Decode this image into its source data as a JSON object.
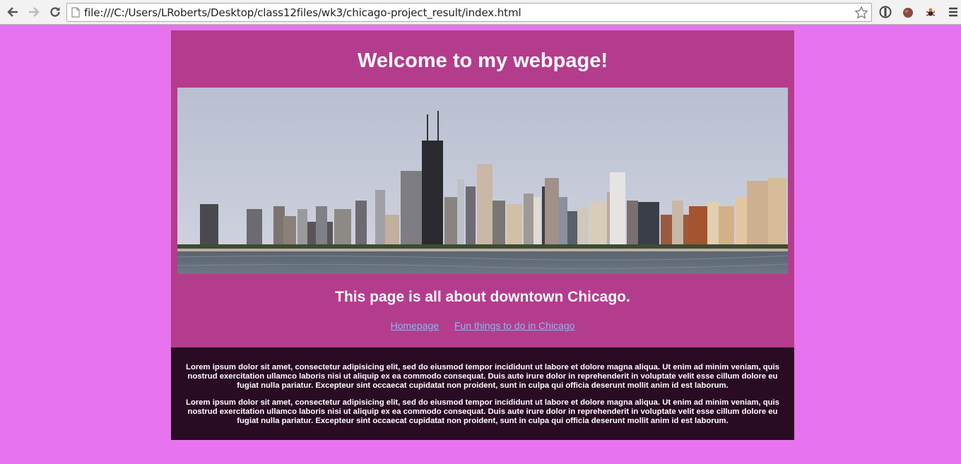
{
  "browser": {
    "url": "file:///C:/Users/LRoberts/Desktop/class12files/wk3/chicago-project_result/index.html"
  },
  "page": {
    "title": "Welcome to my webpage!",
    "subtitle": "This page is all about downtown Chicago.",
    "nav": [
      {
        "label": "Homepage"
      },
      {
        "label": "Fun things to do in Chicago"
      }
    ],
    "paragraphs": [
      "Lorem ipsum dolor sit amet, consectetur adipisicing elit, sed do eiusmod tempor incididunt ut labore et dolore magna aliqua. Ut enim ad minim veniam, quis nostrud exercitation ullamco laboris nisi ut aliquip ex ea commodo consequat. Duis aute irure dolor in reprehenderit in voluptate velit esse cillum dolore eu fugiat nulla pariatur. Excepteur sint occaecat cupidatat non proident, sunt in culpa qui officia deserunt mollit anim id est laborum.",
      "Lorem ipsum dolor sit amet, consectetur adipisicing elit, sed do eiusmod tempor incididunt ut labore et dolore magna aliqua. Ut enim ad minim veniam, quis nostrud exercitation ullamco laboris nisi ut aliquip ex ea commodo consequat. Duis aute irure dolor in reprehenderit in voluptate velit esse cillum dolore eu fugiat nulla pariatur. Excepteur sint occaecat cupidatat non proident, sunt in culpa qui officia deserunt mollit anim id est laborum."
    ]
  },
  "colors": {
    "page_background": "#e873ef",
    "header_background": "#b43c8d",
    "content_background": "#290b23",
    "link": "#8fb6f0"
  }
}
